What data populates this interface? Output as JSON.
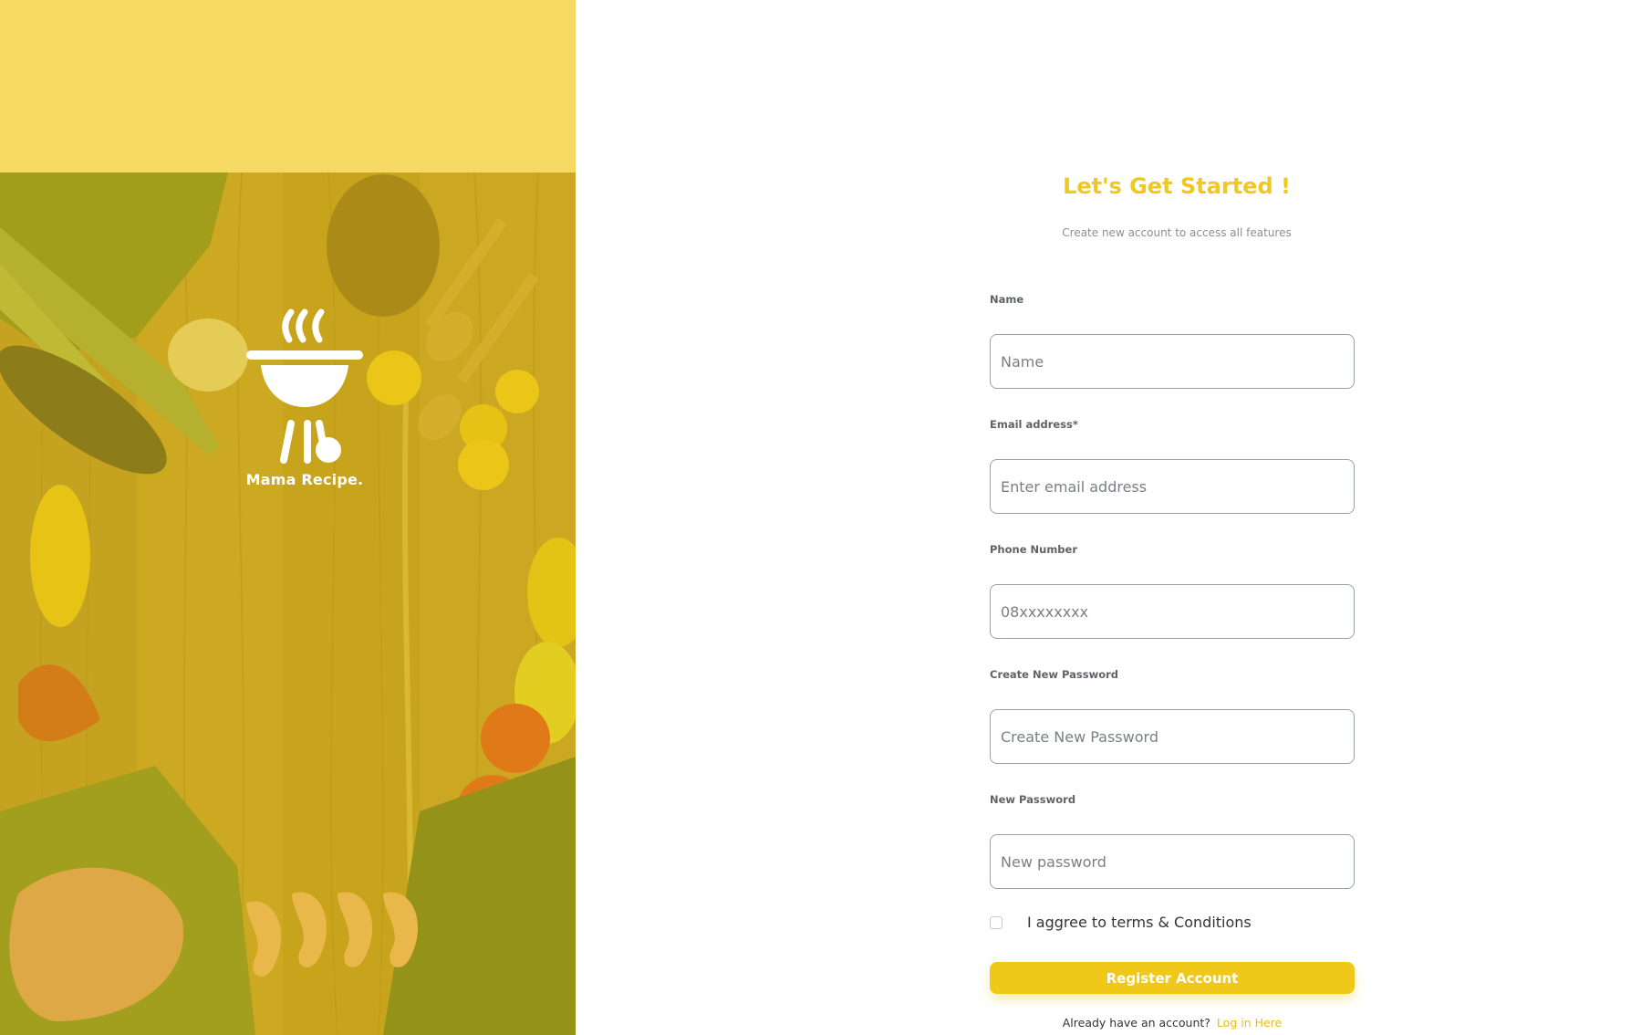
{
  "brand": {
    "name": "Mama Recipe."
  },
  "form": {
    "heading": "Let's Get Started !",
    "subheading": "Create new account to access all features",
    "fields": [
      {
        "label": "Name",
        "placeholder": "Name",
        "value": ""
      },
      {
        "label": "Email address*",
        "placeholder": "Enter email address",
        "value": ""
      },
      {
        "label": "Phone Number",
        "placeholder": "08xxxxxxxx",
        "value": ""
      },
      {
        "label": "Create New Password",
        "placeholder": "Create New Password",
        "value": ""
      },
      {
        "label": "New Password",
        "placeholder": "New password",
        "value": ""
      }
    ],
    "agree_text": "I aggree to terms & Conditions",
    "agree_checked": false,
    "register_button": "Register Account",
    "login_prompt": "Already have an account?",
    "login_link": "Log in Here"
  },
  "icons": {
    "logo": "barbecue-grill-icon",
    "checkbox": "checkbox-unchecked"
  },
  "colors": {
    "accent": "#efc81a",
    "top_band": "#f5d962",
    "link": "#efb91a"
  }
}
